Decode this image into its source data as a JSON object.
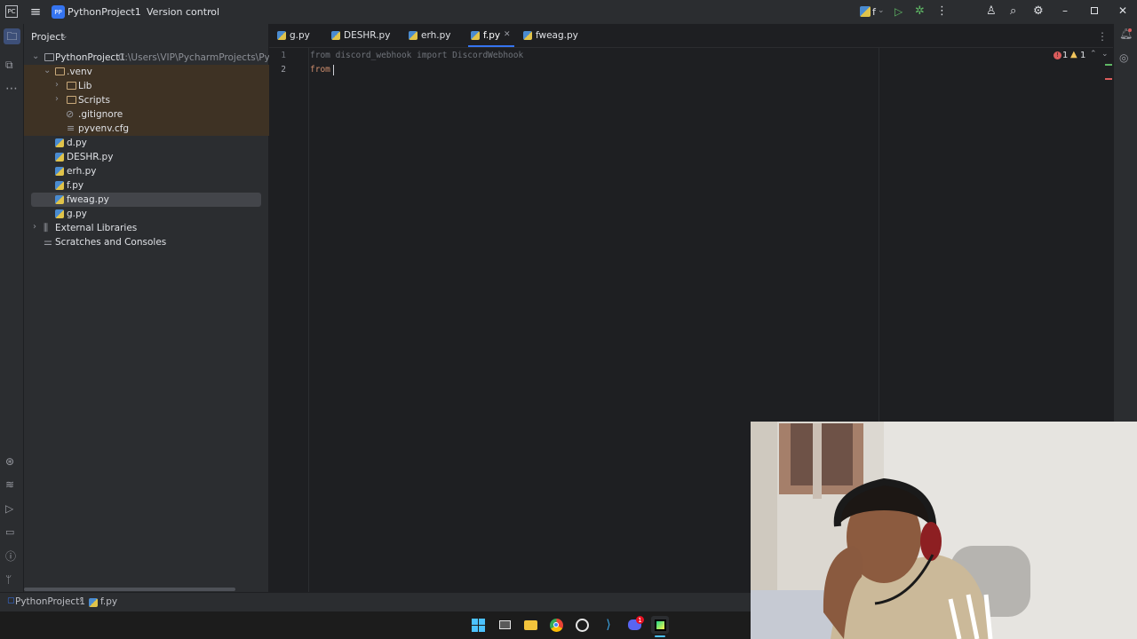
{
  "titlebar": {
    "project_badge": "PP",
    "project_name": "PythonProject1",
    "version_control": "Version control",
    "run_config": "f",
    "icons": [
      "app-menu-icon",
      "hamburger-icon",
      "run-icon",
      "debug-icon",
      "more-icon",
      "account-icon",
      "search-icon",
      "settings-icon",
      "minimize-icon",
      "restore-icon",
      "close-icon"
    ]
  },
  "project_panel": {
    "title": "Project",
    "root": {
      "name": "PythonProject1",
      "path": "C:\\Users\\VIP\\PycharmProjects\\PythonP"
    },
    "items": [
      {
        "label": ".venv",
        "kind": "folder"
      },
      {
        "label": "Lib",
        "kind": "folder"
      },
      {
        "label": "Scripts",
        "kind": "folder"
      },
      {
        "label": ".gitignore",
        "kind": "ignore"
      },
      {
        "label": "pyvenv.cfg",
        "kind": "cfg"
      },
      {
        "label": "d.py",
        "kind": "py"
      },
      {
        "label": "DESHR.py",
        "kind": "py"
      },
      {
        "label": "erh.py",
        "kind": "py"
      },
      {
        "label": "f.py",
        "kind": "py"
      },
      {
        "label": "fweag.py",
        "kind": "py"
      },
      {
        "label": "g.py",
        "kind": "py"
      },
      {
        "label": "External Libraries",
        "kind": "library"
      },
      {
        "label": "Scratches and Consoles",
        "kind": "scratch"
      }
    ]
  },
  "editor": {
    "tabs": [
      {
        "label": "g.py"
      },
      {
        "label": "DESHR.py"
      },
      {
        "label": "erh.py"
      },
      {
        "label": "f.py",
        "active": true
      },
      {
        "label": "fweag.py"
      }
    ],
    "lines": [
      {
        "number": "1",
        "text": "from discord_webhook import DiscordWebhook"
      },
      {
        "number": "2",
        "text": "from "
      }
    ],
    "inspections": {
      "errors": "1",
      "warnings": "1"
    }
  },
  "statusbar": {
    "breadcrumb": [
      "PythonProject1",
      "f.py"
    ]
  },
  "taskbar": {
    "notification_badge": "1"
  },
  "colors": {
    "accent": "#3574f0",
    "background": "#1e1f22",
    "panel": "#2b2d30",
    "error": "#db5c5c",
    "warning": "#f2c55c"
  }
}
